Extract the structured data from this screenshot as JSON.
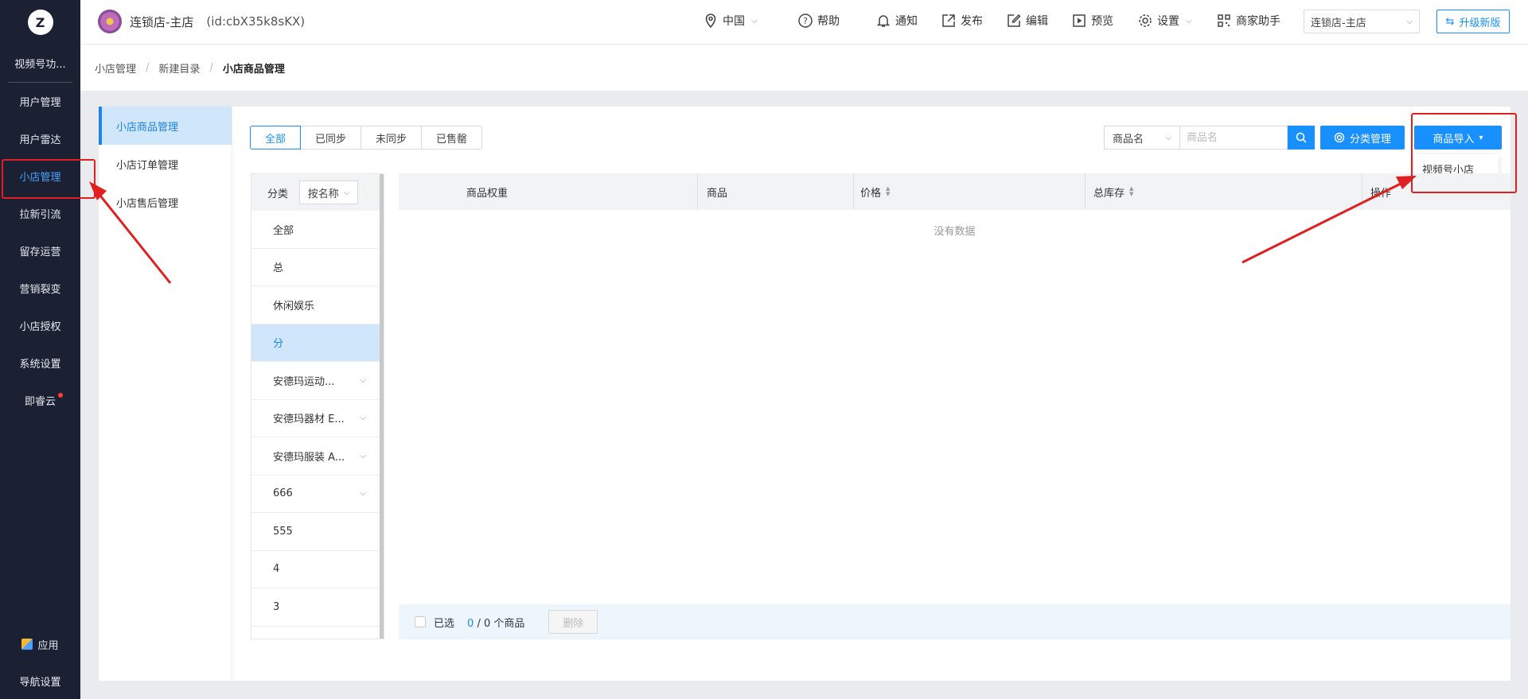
{
  "logo_letter": "Z",
  "sidebar": {
    "items": [
      {
        "label": "视频号功..."
      },
      {
        "label": "用户管理"
      },
      {
        "label": "用户雷达"
      },
      {
        "label": "小店管理"
      },
      {
        "label": "拉新引流"
      },
      {
        "label": "留存运营"
      },
      {
        "label": "营销裂变"
      },
      {
        "label": "小店授权"
      },
      {
        "label": "系统设置"
      },
      {
        "label": "即睿云"
      }
    ],
    "bottom": [
      {
        "label": "应用"
      },
      {
        "label": "导航设置"
      }
    ]
  },
  "header": {
    "shop_name": "连锁店-主店",
    "shop_id": "(id:cbX35k8sKX)",
    "region": "中国",
    "help": "帮助",
    "notify": "通知",
    "publish": "发布",
    "edit": "编辑",
    "preview": "预览",
    "settings": "设置",
    "assistant": "商家助手",
    "store_select": "连锁店-主店",
    "upgrade": "升级新版"
  },
  "breadcrumb": [
    "小店管理",
    "新建目录",
    "小店商品管理"
  ],
  "subnav": [
    "小店商品管理",
    "小店订单管理",
    "小店售后管理"
  ],
  "tabs": [
    "全部",
    "已同步",
    "未同步",
    "已售罄"
  ],
  "search": {
    "field": "商品名",
    "placeholder": "商品名"
  },
  "buttons": {
    "category": "分类管理",
    "import": "商品导入",
    "import_menu_item": "视频号小店",
    "delete": "删除"
  },
  "categories": {
    "header": "分类",
    "sort": "按名称",
    "items": [
      {
        "label": "全部"
      },
      {
        "label": "总"
      },
      {
        "label": "休闲娱乐"
      },
      {
        "label": "分"
      },
      {
        "label": "安德玛运动..."
      },
      {
        "label": "安德玛器材 E..."
      },
      {
        "label": "安德玛服装 A..."
      },
      {
        "label": "666"
      },
      {
        "label": "555"
      },
      {
        "label": "4"
      },
      {
        "label": "3"
      }
    ]
  },
  "table": {
    "columns": [
      "商品权重",
      "商品",
      "价格",
      "总库存",
      "操作"
    ],
    "empty": "没有数据"
  },
  "footer": {
    "selected_label": "已选",
    "selected_count": "0",
    "total": "/ 0 个商品"
  },
  "colors": {
    "primary": "#1890ff",
    "sidebar_bg": "#1b2133",
    "annotation": "#e02020"
  }
}
